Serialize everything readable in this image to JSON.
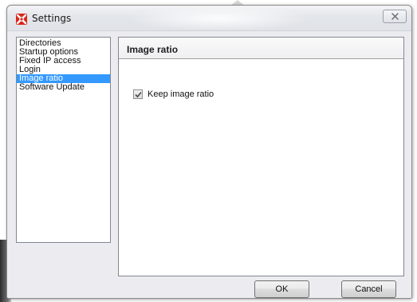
{
  "window": {
    "title": "Settings",
    "icon": "settings-app-icon",
    "close_icon": "close-icon"
  },
  "nav": {
    "items": [
      {
        "label": "Directories",
        "selected": false
      },
      {
        "label": "Startup options",
        "selected": false
      },
      {
        "label": "Fixed IP access",
        "selected": false
      },
      {
        "label": "Login",
        "selected": false
      },
      {
        "label": "Image ratio",
        "selected": true
      },
      {
        "label": "Software Update",
        "selected": false
      }
    ]
  },
  "panel": {
    "title": "Image ratio",
    "keep_ratio": {
      "label": "Keep image ratio",
      "checked": true
    }
  },
  "buttons": {
    "ok": "OK",
    "cancel": "Cancel"
  },
  "colors": {
    "selection": "#3399ff",
    "icon_red": "#d9261c"
  }
}
